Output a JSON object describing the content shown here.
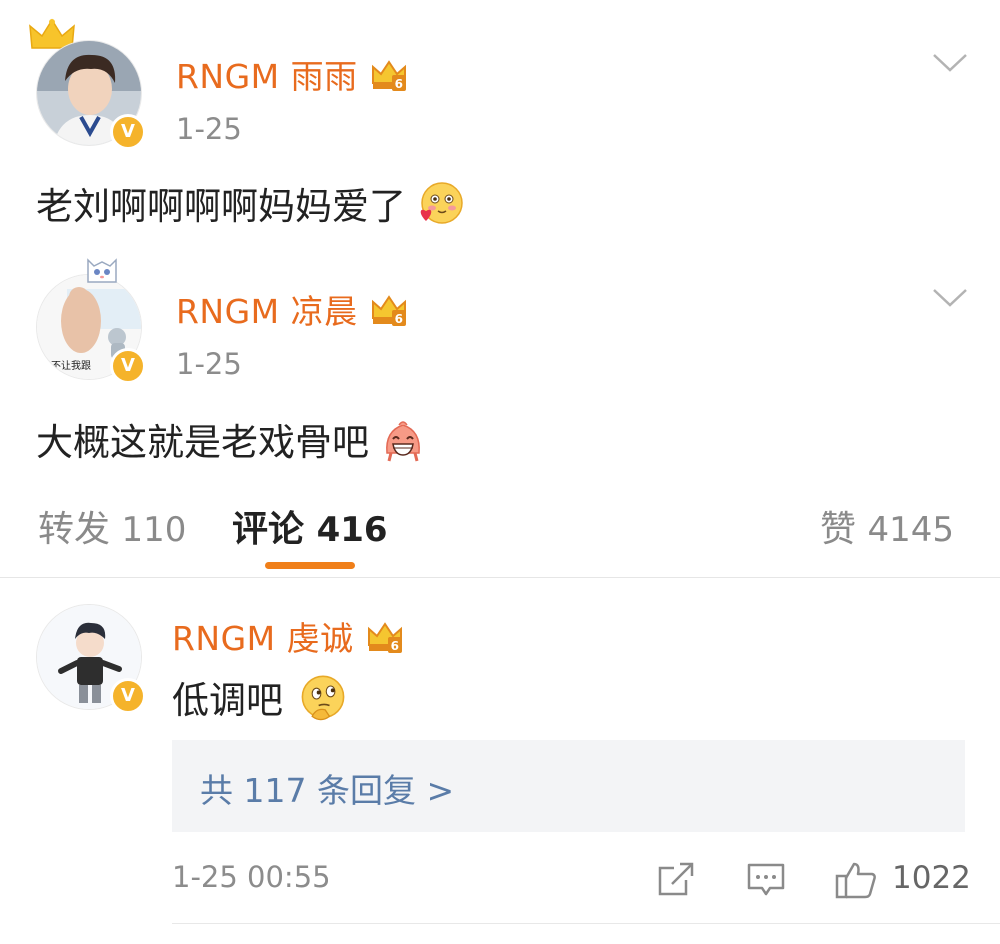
{
  "posts": [
    {
      "username": "RNGM 雨雨",
      "date": "1-25",
      "content": "老刘啊啊啊啊妈妈爱了",
      "verified_label": "V",
      "vip_level": "6",
      "emoji": "blush-heart-emoji"
    },
    {
      "username": "RNGM 凉晨",
      "date": "1-25",
      "content": "大概这就是老戏骨吧",
      "avatar_text": "妈不让我跟",
      "verified_label": "V",
      "vip_level": "6",
      "emoji": "grin-emoji"
    }
  ],
  "tabs": {
    "repost": {
      "label": "转发",
      "count": "110"
    },
    "comments": {
      "label": "评论",
      "count": "416"
    },
    "likes": {
      "label": "赞",
      "count": "4145"
    }
  },
  "comment": {
    "username": "RNGM 虔诚",
    "content": "低调吧",
    "verified_label": "V",
    "vip_level": "6",
    "replies_link": "共 117 条回复 >",
    "timestamp": "1-25 00:55",
    "like_count": "1022",
    "emoji": "thinking-emoji"
  },
  "colors": {
    "username": "#e86b1e",
    "accent": "#f07f19",
    "link": "#5a7ca8",
    "badge": "#f5b32b"
  }
}
